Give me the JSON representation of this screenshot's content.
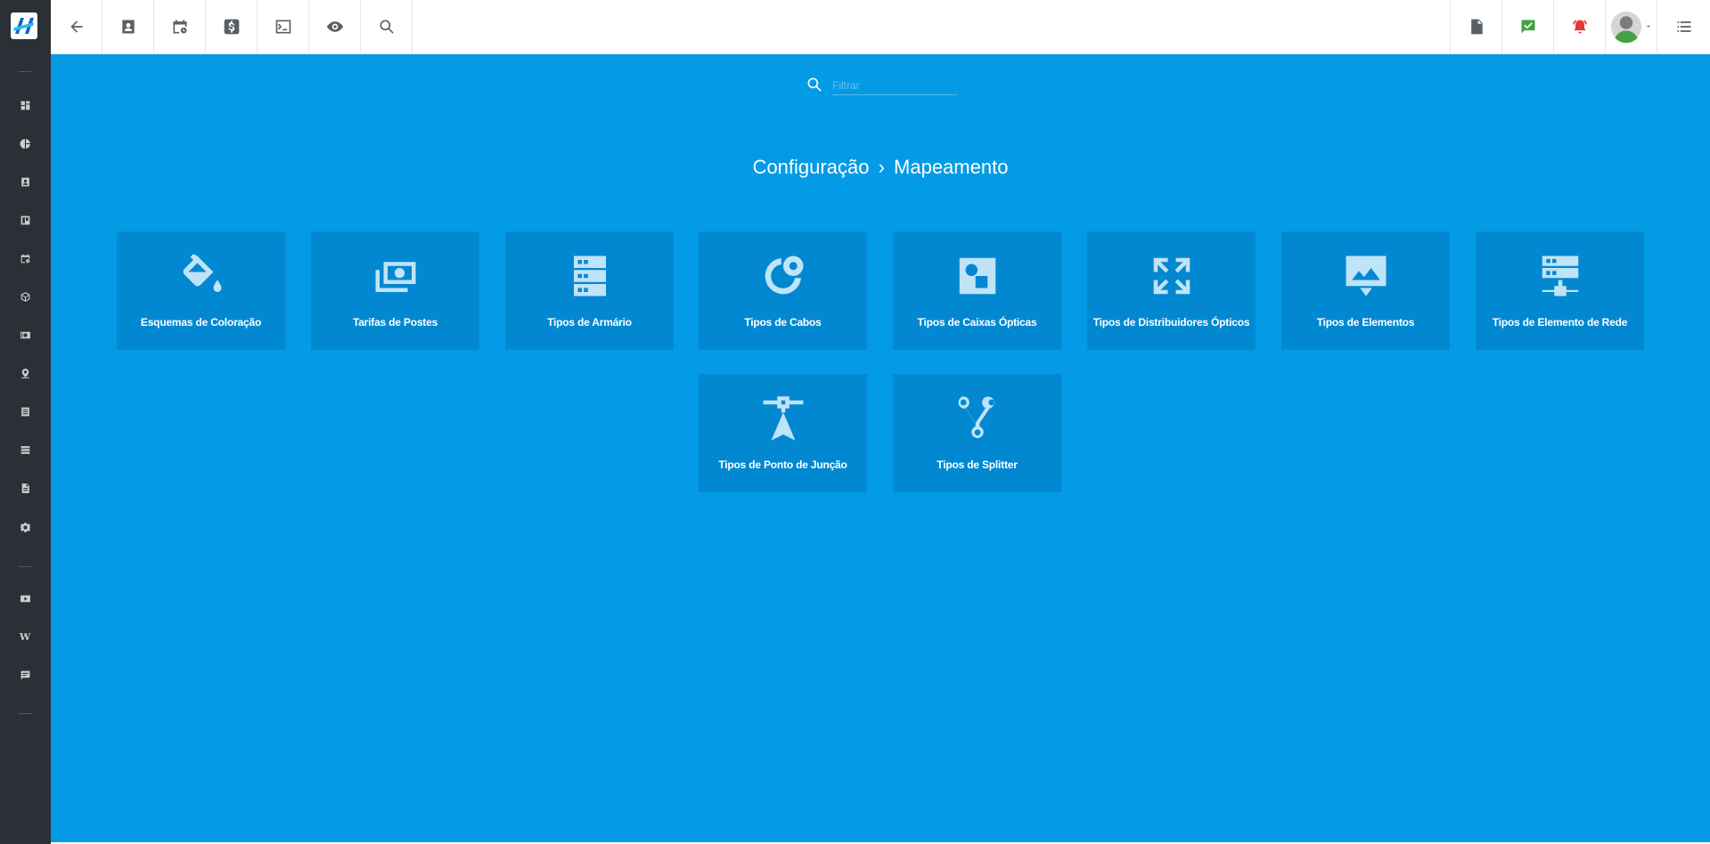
{
  "sidebar": {
    "logo_icon": "app-logo",
    "items": [
      "dashboard-icon",
      "pie-chart-icon",
      "contact-card-icon",
      "map-board-icon",
      "calendar-clock-icon",
      "cube-icon",
      "money-icon",
      "map-pin-icon",
      "list-icon",
      "server-icon",
      "document-icon",
      "gear-icon",
      "video-icon",
      "wiki-icon",
      "chat-icon"
    ],
    "wiki_letter": "W"
  },
  "topbar": {
    "left_icons": [
      "back-arrow-icon",
      "contact-icon",
      "calendar-clock-icon",
      "dollar-icon",
      "terminal-icon",
      "eye-icon",
      "search-icon"
    ],
    "right_icons": [
      "pdf-icon",
      "chat-check-icon",
      "alarm-icon",
      "avatar",
      "menu-list-icon"
    ],
    "accent_green": "#43a047",
    "accent_red": "#e53935"
  },
  "main": {
    "background": "#039be5",
    "filter": {
      "placeholder": "Filtrar",
      "value": ""
    },
    "breadcrumb": {
      "parent": "Configuração",
      "separator": "›",
      "current": "Mapeamento"
    },
    "cards": [
      {
        "label": "Esquemas de Coloração",
        "icon": "paint-bucket-icon"
      },
      {
        "label": "Tarifas de Postes",
        "icon": "money-stack-icon"
      },
      {
        "label": "Tipos de Armário",
        "icon": "cabinet-icon"
      },
      {
        "label": "Tipos de Cabos",
        "icon": "cable-icon"
      },
      {
        "label": "Tipos de Caixas Ópticas",
        "icon": "optical-box-icon"
      },
      {
        "label": "Tipos de Distribuidores Ópticos",
        "icon": "expand-arrows-icon"
      },
      {
        "label": "Tipos de Elementos",
        "icon": "image-frame-icon"
      },
      {
        "label": "Tipos de Elemento de Rede",
        "icon": "network-server-icon"
      },
      {
        "label": "Tipos de Ponto de Junção",
        "icon": "junction-point-icon"
      },
      {
        "label": "Tipos de Splitter",
        "icon": "splitter-icon"
      }
    ]
  }
}
